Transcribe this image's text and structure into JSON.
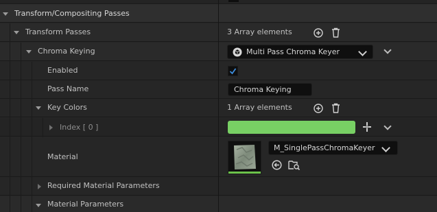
{
  "section": {
    "title": "Transform/Compositing Passes"
  },
  "transform_passes": {
    "label": "Transform Passes",
    "value": "3 Array elements"
  },
  "chroma_keying": {
    "label": "Chroma Keying",
    "dropdown_value": "Multi Pass Chroma Keyer"
  },
  "enabled": {
    "label": "Enabled",
    "checked": true
  },
  "pass_name": {
    "label": "Pass Name",
    "value": "Chroma Keying"
  },
  "key_colors": {
    "label": "Key Colors",
    "value": "1 Array elements"
  },
  "index0": {
    "label": "Index [ 0 ]",
    "color": "#78d064"
  },
  "material": {
    "label": "Material",
    "dropdown_value": "M_SinglePassChromaKeyer"
  },
  "required_params": {
    "label": "Required Material Parameters"
  },
  "material_params": {
    "label": "Material Parameters"
  },
  "icons": [
    "add-element-icon",
    "trash-icon",
    "chevron-down-icon",
    "cube-icon",
    "checkmark-icon",
    "color-picker-icon",
    "use-asset-icon",
    "browse-asset-icon"
  ]
}
